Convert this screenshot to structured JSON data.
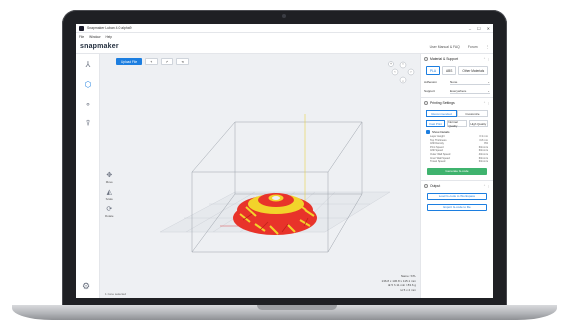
{
  "app": {
    "title": "Snapmaker Luban 4.0 alpha9",
    "window_controls": [
      "–",
      "☐",
      "✕"
    ],
    "menu": [
      "File",
      "Window",
      "Help"
    ],
    "logo": "snapmaker",
    "header_links": [
      "User Manual & FAQ",
      "Forum"
    ],
    "header_more": "⋮"
  },
  "sidebar": {
    "icons": [
      "axis-icon",
      "cube-icon",
      "laser-icon",
      "cnc-icon"
    ],
    "settings_icon": "gear-icon"
  },
  "viewport": {
    "toolbar": [
      "Upload File",
      "↰",
      "↱",
      "⟲"
    ],
    "tools": [
      {
        "label": "Move",
        "icon": "✥"
      },
      {
        "label": "Scale",
        "icon": "◭"
      },
      {
        "label": "Rotate",
        "icon": "⟳"
      }
    ],
    "info_lines": [
      "Name: STL",
      "136.8 x 136.8 x 115.1 mm",
      "⊕ 5 h 11 min / 83.6 g",
      "⊟ 5 x 2 mm"
    ],
    "footer": "1 zone selected"
  },
  "panel": {
    "material": {
      "title": "Material & Support",
      "materials": [
        "PLA",
        "ABS",
        "Other Materials"
      ],
      "selected": "PLA",
      "adhesion_label": "Adhesion",
      "adhesion_value": "None",
      "support_label": "Support",
      "support_value": "Everywhere"
    },
    "printing": {
      "title": "Printing Settings",
      "tabs": [
        "Recommended",
        "Customize"
      ],
      "active_tab": "Recommended",
      "qualities": [
        "Fast Print",
        "Normal Quality",
        "High Quality"
      ],
      "active_quality": "Fast Print",
      "details_label": "Show Details",
      "params": [
        [
          "Layer Height",
          "0.3 mm"
        ],
        [
          "Top Thickness",
          "0.8 mm"
        ],
        [
          "Infill Density",
          "8%"
        ],
        [
          "Print Speed",
          "60mm/s"
        ],
        [
          "Infill Speed",
          "60mm/s"
        ],
        [
          "Outer Wall Speed",
          "40mm/s"
        ],
        [
          "Inner Wall Speed",
          "60mm/s"
        ],
        [
          "Travel Speed",
          "60mm/s"
        ]
      ],
      "generate_label": "Generate G-code"
    },
    "output": {
      "title": "Output",
      "btn_workspace": "Load G-code to Workspace",
      "btn_export": "Export G-code to file"
    }
  },
  "colors": {
    "accent": "#1c7ee0",
    "model_primary": "#e8332a",
    "model_secondary": "#f2d32b",
    "generate": "#3fb36e"
  }
}
